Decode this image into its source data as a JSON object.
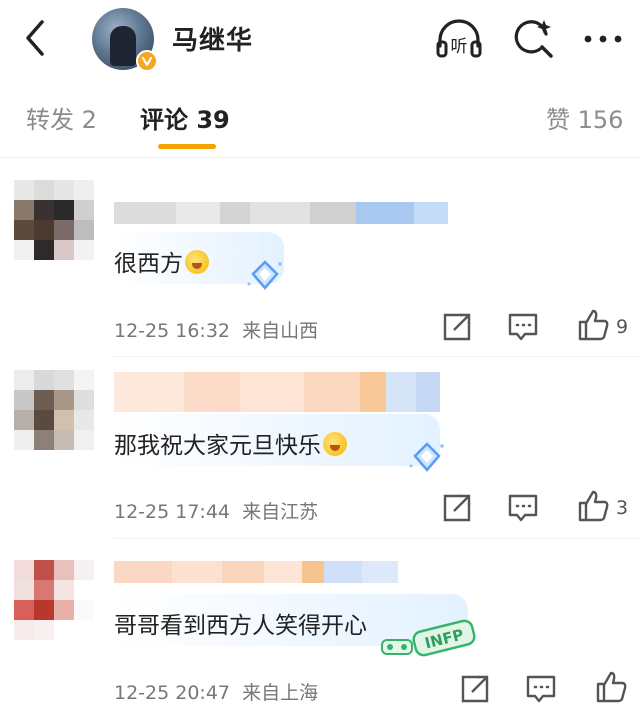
{
  "header": {
    "username": "马继华",
    "listen_label": "听",
    "icons": {
      "back": "chevron-left-icon",
      "listen": "headphones-icon",
      "search": "sparkle-search-icon",
      "more": "more-dots-icon"
    }
  },
  "tabs": {
    "repost": "转发 2",
    "comments": "评论 39",
    "likes": "赞 156"
  },
  "comments": [
    {
      "text": "很西方",
      "time": "12-25 16:32",
      "location": "来自山西",
      "likes": "9"
    },
    {
      "text": "那我祝大家元旦快乐",
      "time": "12-25 17:44",
      "location": "来自江苏",
      "likes": "3"
    },
    {
      "text": "哥哥看到西方人笑得开心",
      "time": "12-25 20:47",
      "location": "来自上海",
      "likes": ""
    }
  ],
  "badges": {
    "fan_badge_text": "INFP"
  },
  "colors": {
    "accent": "#f4a300",
    "meta_text": "#777777",
    "inactive_tab": "#8c8c8c"
  }
}
